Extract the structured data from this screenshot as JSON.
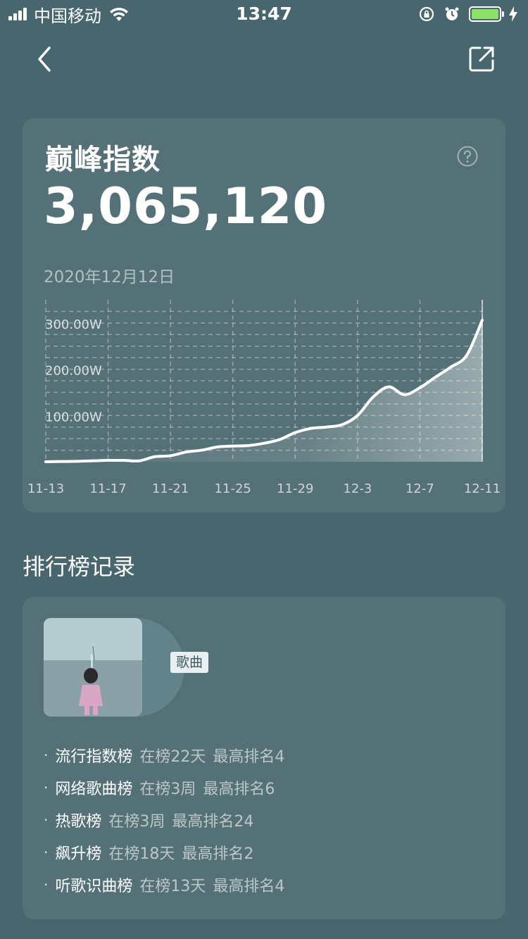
{
  "status_bar": {
    "carrier": "中国移动",
    "time": "13:47"
  },
  "card": {
    "title": "巅峰指数",
    "value": "3,065,120",
    "date": "2020年12月12日"
  },
  "chart_data": {
    "type": "area",
    "title": "",
    "xlabel": "",
    "ylabel": "",
    "x_tick_labels": [
      "11-13",
      "11-17",
      "11-21",
      "11-25",
      "11-29",
      "12-3",
      "12-7",
      "12-11"
    ],
    "y_tick_labels": [
      "100.00W",
      "200.00W",
      "300.00W"
    ],
    "y_ticks": [
      100,
      200,
      300
    ],
    "ylim": [
      0,
      350
    ],
    "grid": true,
    "x": [
      "11-13",
      "11-14",
      "11-15",
      "11-16",
      "11-17",
      "11-18",
      "11-19",
      "11-20",
      "11-21",
      "11-22",
      "11-23",
      "11-24",
      "11-25",
      "11-26",
      "11-27",
      "11-28",
      "11-29",
      "11-30",
      "12-1",
      "12-2",
      "12-3",
      "12-4",
      "12-5",
      "12-6",
      "12-7",
      "12-8",
      "12-9",
      "12-10",
      "12-11"
    ],
    "series": [
      {
        "values": [
          0,
          0.5,
          1,
          2,
          3,
          3,
          2,
          11,
          13,
          21,
          25,
          32,
          34,
          35,
          40,
          48,
          63,
          72,
          75,
          80,
          100,
          140,
          162,
          145,
          160,
          183,
          205,
          230,
          306
        ]
      }
    ],
    "line_color": "#ffffff",
    "fill_color": "#ffffff"
  },
  "section": {
    "title": "排行榜记录"
  },
  "record": {
    "tag": "歌曲",
    "items": [
      {
        "bullet": "·",
        "name": "流行指数榜",
        "duration": "在榜22天",
        "best": "最高排名4"
      },
      {
        "bullet": "·",
        "name": "网络歌曲榜",
        "duration": "在榜3周",
        "best": "最高排名6"
      },
      {
        "bullet": "·",
        "name": "热歌榜",
        "duration": "在榜3周",
        "best": "最高排名24"
      },
      {
        "bullet": "·",
        "name": "飙升榜",
        "duration": "在榜18天",
        "best": "最高排名2"
      },
      {
        "bullet": "·",
        "name": "听歌识曲榜",
        "duration": "在榜13天",
        "best": "最高排名4"
      }
    ]
  }
}
